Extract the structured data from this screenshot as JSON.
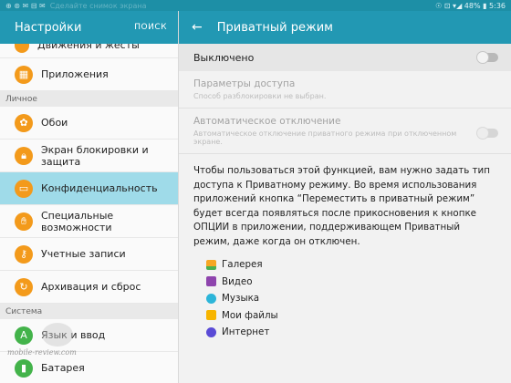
{
  "statusbar": {
    "left_text": "⊕ ⊛ ✉ ⊟ ✉",
    "faded_text": "Сделайте снимок экрана",
    "right_text": "☉ ⊡ ▾◢ 48% ▮ 5:36"
  },
  "left": {
    "title": "Настройки",
    "search": "ПОИСК",
    "partial_item": "Движения и жесты",
    "items_top": [
      {
        "label": "Приложения",
        "icon": "apps-icon"
      }
    ],
    "section_personal": "Личное",
    "items_personal": [
      {
        "label": "Обои",
        "icon": "wallpaper-icon"
      },
      {
        "label": "Экран блокировки и защита",
        "icon": "lock-icon"
      },
      {
        "label": "Конфиденциальность",
        "icon": "privacy-icon"
      },
      {
        "label": "Специальные возможности",
        "icon": "accessibility-icon"
      },
      {
        "label": "Учетные записи",
        "icon": "accounts-icon"
      },
      {
        "label": "Архивация и сброс",
        "icon": "backup-icon"
      }
    ],
    "section_system": "Система",
    "items_system": [
      {
        "label": "Язык и ввод",
        "icon": "language-icon"
      },
      {
        "label": "Батарея",
        "icon": "battery-icon"
      }
    ],
    "watermark": "mobile-review.com"
  },
  "right": {
    "back": "←",
    "title": "Приватный режим",
    "main_switch": "Выключено",
    "pref_access_title": "Параметры доступа",
    "pref_access_summary": "Способ разблокировки не выбран.",
    "pref_auto_title": "Автоматическое отключение",
    "pref_auto_summary": "Автоматическое отключение приватного режима при отключенном экране.",
    "description": "Чтобы пользоваться этой функцией, вам нужно задать тип доступа к Приватному режиму. Во время использования приложений кнопка “Переместить в приватный режим” будет всегда появляться после прикосновения к кнопке ОПЦИИ в приложении, поддерживающем Приватный режим, даже когда он отключен.",
    "apps": [
      {
        "label": "Галерея",
        "icon": "gallery-icon",
        "color": "#f6a623"
      },
      {
        "label": "Видео",
        "icon": "video-icon",
        "color": "#8e44ad"
      },
      {
        "label": "Музыка",
        "icon": "music-icon",
        "color": "#2cb5d9"
      },
      {
        "label": "Мои файлы",
        "icon": "folder-icon",
        "color": "#f7b500"
      },
      {
        "label": "Интернет",
        "icon": "internet-icon",
        "color": "#5a4bd6"
      }
    ]
  },
  "colors": {
    "accent": "#2298b3",
    "selected": "#9fdbe9",
    "settings_icon_orange": "#f39a1b",
    "settings_icon_green": "#43b34a"
  }
}
